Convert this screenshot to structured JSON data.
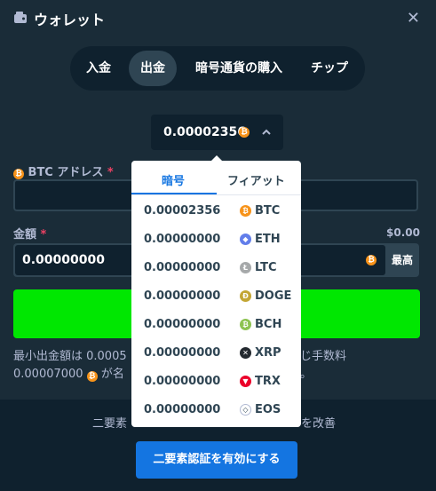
{
  "header": {
    "title": "ウォレット",
    "close_glyph": "✕"
  },
  "tabs": [
    {
      "label": "入金",
      "active": false
    },
    {
      "label": "出金",
      "active": true
    },
    {
      "label": "暗号通貨の購入",
      "active": false
    },
    {
      "label": "チップ",
      "active": false
    }
  ],
  "currency_select": {
    "amount": "0.00002356",
    "coin_glyph": "₿",
    "chevron_glyph": "^"
  },
  "address": {
    "label": "BTC アドレス",
    "required": "*",
    "value": ""
  },
  "amount": {
    "label": "金額",
    "required": "*",
    "usd_value": "$0.00",
    "value": "0.00000000",
    "max_label": "最高"
  },
  "minimum_note": {
    "line1": "最小出金額は 0.0005",
    "line1_right": "じ手数料",
    "line2_value": "0.00007000",
    "line2_text": "が名",
    "line2_right": "。"
  },
  "footer": {
    "text_left": "二要素",
    "text_right": "を改善",
    "button_label": "二要素認証を有効にする"
  },
  "dropdown": {
    "tab_crypto": "暗号",
    "tab_fiat": "フィアット",
    "items": [
      {
        "value": "0.00002356",
        "symbol": "BTC",
        "glyph": "₿",
        "color": "#f7931a"
      },
      {
        "value": "0.00000000",
        "symbol": "ETH",
        "glyph": "◆",
        "color": "#627eea"
      },
      {
        "value": "0.00000000",
        "symbol": "LTC",
        "glyph": "Ł",
        "color": "#a6a9aa"
      },
      {
        "value": "0.00000000",
        "symbol": "DOGE",
        "glyph": "Ð",
        "color": "#c3a634"
      },
      {
        "value": "0.00000000",
        "symbol": "BCH",
        "glyph": "₿",
        "color": "#8dc351"
      },
      {
        "value": "0.00000000",
        "symbol": "XRP",
        "glyph": "✕",
        "color": "#23292f"
      },
      {
        "value": "0.00000000",
        "symbol": "TRX",
        "glyph": "▼",
        "color": "#eb0029"
      },
      {
        "value": "0.00000000",
        "symbol": "EOS",
        "glyph": "◇",
        "color": "#ffffff"
      }
    ]
  },
  "colors": {
    "accent_green": "#00e701",
    "accent_blue": "#1475e1",
    "background": "#1a2c38",
    "panel": "#0f212e"
  }
}
